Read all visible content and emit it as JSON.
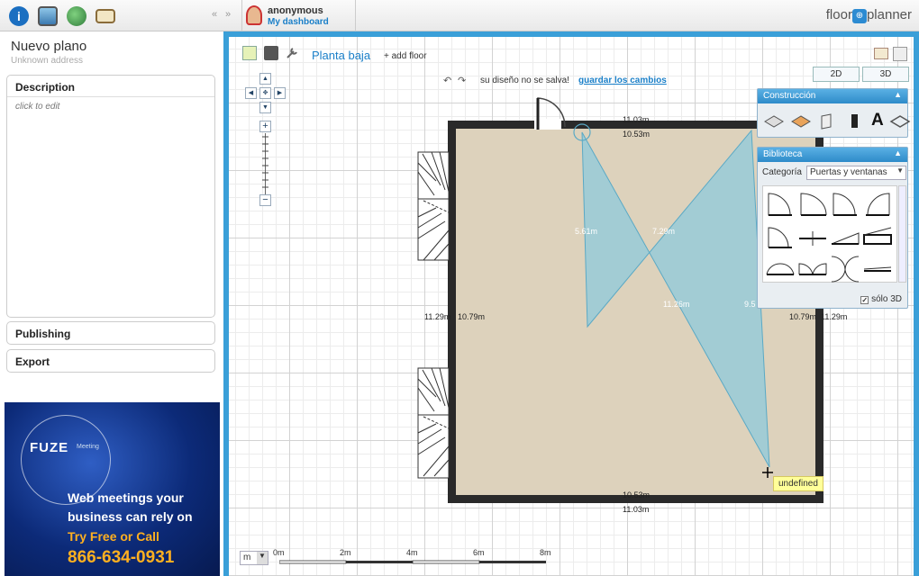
{
  "topbar": {
    "icons": [
      "info-icon",
      "gallery-icon",
      "globe-icon",
      "mail-icon"
    ],
    "collapse_left": "«",
    "collapse_right": "»",
    "user_name": "anonymous",
    "dashboard_link": "My dashboard",
    "brand_left": "floor",
    "brand_logo": "⊕",
    "brand_right": "planner"
  },
  "sidebar": {
    "plan_name": "Nuevo plano",
    "plan_address": "Unknown address",
    "description_title": "Description",
    "description_hint": "click to edit",
    "sections": [
      "Publishing",
      "Export"
    ]
  },
  "ad": {
    "brand": "FUZE",
    "brand_sub": "Meeting",
    "line1": "Web meetings your",
    "line2": "business can rely on",
    "line3": "Try Free or Call",
    "phone": "866-634-0931"
  },
  "editor": {
    "floor_name": "Planta baja",
    "add_floor": "+ add floor",
    "undo_icon": "↶",
    "redo_icon": "↷",
    "save_note": "su diseño no se salva!",
    "save_link": "guardar los cambios",
    "view_2d": "2D",
    "view_3d": "3D",
    "nav": {
      "up": "▲",
      "down": "▼",
      "left": "◀",
      "right": "▶",
      "center": "✥",
      "zoom_in": "+",
      "zoom_out": "−"
    },
    "tooltip": "undefined"
  },
  "construction_panel": {
    "title": "Construcción",
    "collapse": "▲",
    "tools": [
      "wall-tool-icon",
      "floor-tool-icon",
      "room-tool-icon",
      "door-tool-icon",
      "text-tool-icon",
      "dimension-tool-icon"
    ],
    "text_tool": "A"
  },
  "library_panel": {
    "title": "Biblioteca",
    "collapse": "▲",
    "category_label": "Categoría",
    "category_value": "Puertas y ventanas",
    "select_arrow": "▼",
    "solo_3d": "sólo 3D",
    "solo_3d_checked": "✓"
  },
  "dimensions": {
    "top_outer": "11.03m",
    "top_inner": "10.53m",
    "bottom_inner": "10.53m",
    "bottom_outer": "11.03m",
    "left_outer": "11.29m",
    "left_inner": "10.79m",
    "right_inner": "10.79m",
    "right_outer": "11.29m",
    "line_a": "5.61m",
    "line_b": "7.29m",
    "line_c": "11.26m",
    "line_d": "9.5"
  },
  "scale_bar": {
    "unit": "m",
    "arrow": "▼",
    "labels": [
      "0m",
      "2m",
      "4m",
      "6m",
      "8m"
    ]
  }
}
